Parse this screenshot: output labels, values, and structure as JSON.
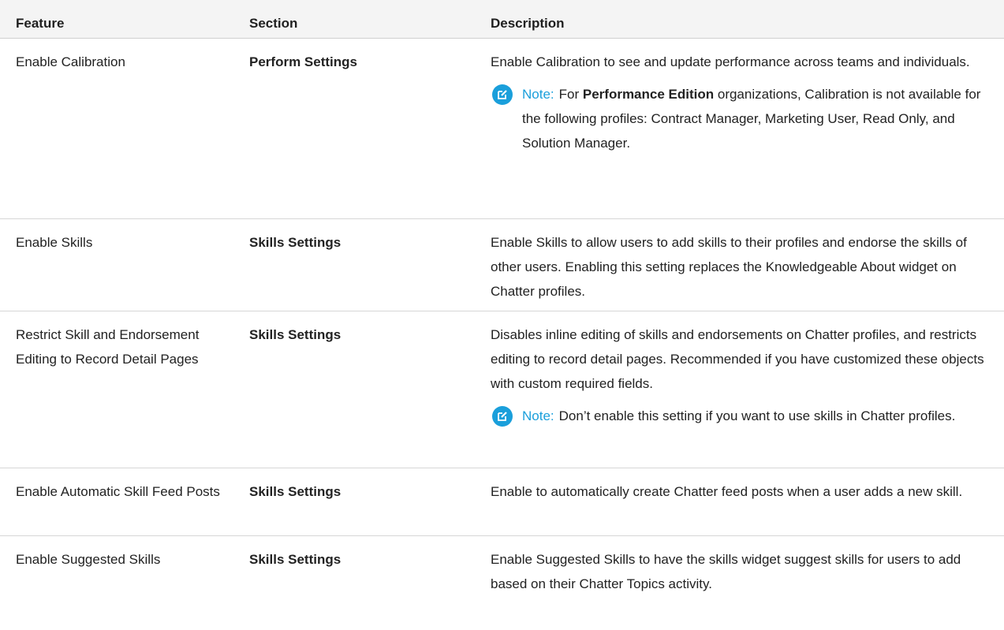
{
  "columns": [
    "Feature",
    "Section",
    "Description"
  ],
  "note_label": "Note:",
  "rows": [
    {
      "feature": "Enable Calibration",
      "section": "Perform Settings",
      "description": "Enable Calibration to see and update performance across teams and individuals.",
      "note": {
        "pre": "For ",
        "bold": "Performance Edition",
        "post": " organizations, Calibration is not available for the following profiles: Contract Manager, Marketing User, Read Only, and Solution Manager."
      }
    },
    {
      "feature": "Enable Skills",
      "section": "Skills Settings",
      "description": "Enable Skills to allow users to add skills to their profiles and endorse the skills of other users. Enabling this setting replaces the Knowledgeable About widget on Chatter profiles."
    },
    {
      "feature": "Restrict Skill and Endorsement Editing to Record Detail Pages",
      "section": "Skills Settings",
      "description": "Disables inline editing of skills and endorsements on Chatter profiles, and restricts editing to record detail pages. Recommended if you have customized these objects with custom required fields.",
      "note": {
        "text": "Don’t enable this setting if you want to use skills in Chatter profiles."
      }
    },
    {
      "feature": "Enable Automatic Skill Feed Posts",
      "section": "Skills Settings",
      "description": "Enable to automatically create Chatter feed posts when a user adds a new skill."
    },
    {
      "feature": "Enable Suggested Skills",
      "section": "Skills Settings",
      "description": "Enable Suggested Skills to have the skills widget suggest skills for users to add based on their Chatter Topics activity."
    }
  ],
  "colors": {
    "note_accent": "#1a9fdb",
    "header_bg": "#f4f4f4",
    "border": "#d6d6d6"
  },
  "icons": {
    "note": "edit-note-icon"
  }
}
